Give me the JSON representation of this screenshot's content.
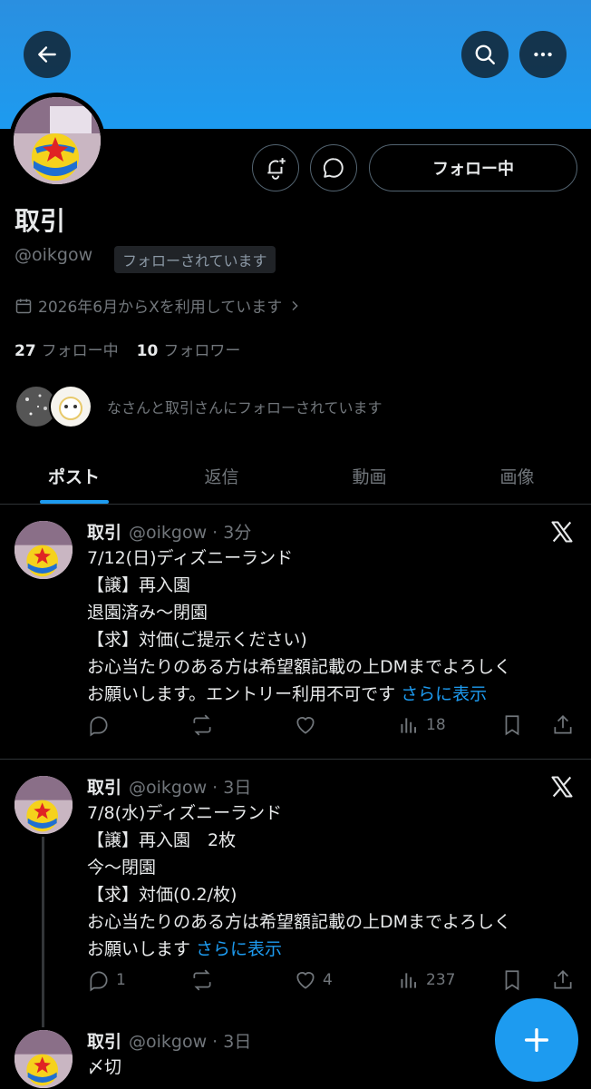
{
  "profile": {
    "name": "取引",
    "handle": "@oikgow",
    "follows_you_badge": "フォローされています",
    "joined": "2026年6月からXを利用しています",
    "following_count": "27",
    "following_label": "フォロー中",
    "followers_count": "10",
    "followers_label": "フォロワー",
    "mutuals_text": "なさんと取引さんにフォローされています",
    "follow_button": "フォロー中"
  },
  "tabs": [
    {
      "label": "ポスト",
      "active": true
    },
    {
      "label": "返信",
      "active": false
    },
    {
      "label": "動画",
      "active": false
    },
    {
      "label": "画像",
      "active": false
    }
  ],
  "posts": [
    {
      "name": "取引",
      "handle_time": "@oikgow · 3分",
      "lines": "7/12(日)ディズニーランド\n【譲】再入園\n退園済み〜閉園\n【求】対価(ご提示ください)\nお心当たりのある方は希望額記載の上DMまでよろしく\nお願いします。エントリー利用不可です",
      "more": "さらに表示",
      "replies": "",
      "reposts": "",
      "likes": "",
      "views": "18"
    },
    {
      "name": "取引",
      "handle_time": "@oikgow · 3日",
      "lines": "7/8(水)ディズニーランド\n【譲】再入園　2枚\n今〜閉園\n【求】対価(0.2/枚)\nお心当たりのある方は希望額記載の上DMまでよろしく\nお願いします",
      "more": "さらに表示",
      "replies": "1",
      "reposts": "",
      "likes": "4",
      "views": "237"
    },
    {
      "name": "取引",
      "handle_time": "@oikgow · 3日",
      "lines": "〆切"
    }
  ],
  "icons": {
    "back": "arrow-left-icon",
    "search": "search-icon",
    "more": "more-icon",
    "notify": "bell-plus-icon",
    "message": "message-icon",
    "calendar": "calendar-icon",
    "compose": "plus-icon"
  },
  "colors": {
    "accent": "#1d9bf0",
    "background": "#000000",
    "muted": "#71767b",
    "text": "#e7e9ea"
  }
}
